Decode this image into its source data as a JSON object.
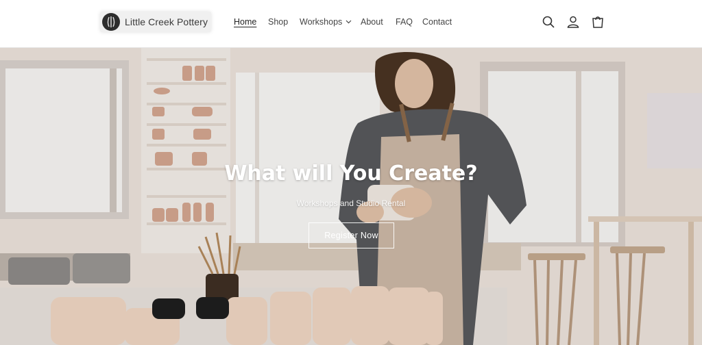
{
  "header": {
    "logo_text": "Little Creek Pottery",
    "nav": [
      {
        "label": "Home",
        "active": true
      },
      {
        "label": "Shop"
      },
      {
        "label": "Workshops",
        "has_dropdown": true
      },
      {
        "label": "About"
      },
      {
        "label": "FAQ"
      },
      {
        "label": "Contact"
      }
    ],
    "icons": [
      "search-icon",
      "account-icon",
      "cart-icon"
    ]
  },
  "hero": {
    "title": "What will You Create?",
    "subtitle": "Workshops and Studio Rental",
    "cta_label": "Register Now"
  }
}
